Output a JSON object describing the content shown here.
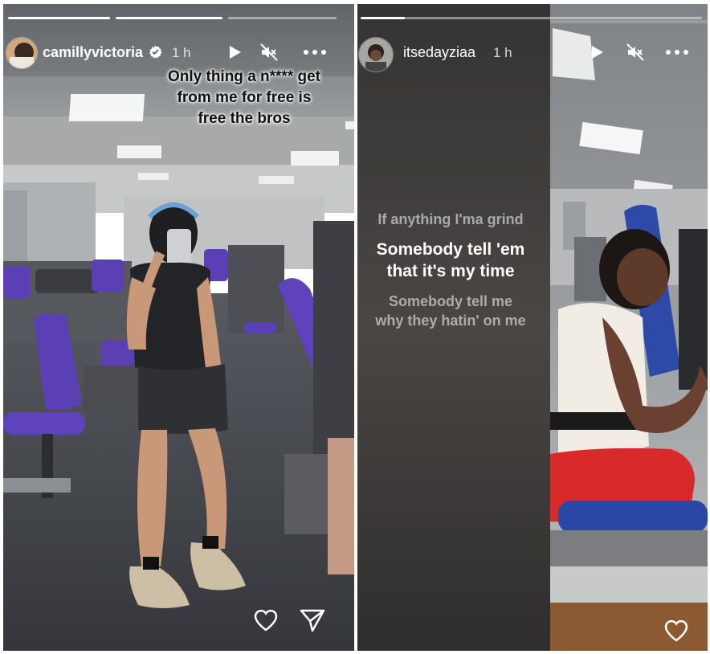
{
  "left_story": {
    "username": "camillyvictoria",
    "time": "1 h",
    "verified": true,
    "caption_lines": [
      "Only thing a n**** get",
      "from me for free is",
      "free the bros"
    ],
    "progress": [
      1,
      1,
      0
    ],
    "icons": {
      "play": "play-icon",
      "mute": "mute-icon",
      "more": "more-icon",
      "like": "heart-icon",
      "share": "send-icon"
    }
  },
  "right_story": {
    "username": "itsedayziaa",
    "time": "1 h",
    "lyrics": {
      "previous": "If anything I'ma grind",
      "current_line1": "Somebody tell 'em",
      "current_line2": "that it's my time",
      "next_line1": "Somebody tell me",
      "next_line2": "why they hatin' on me"
    },
    "progress": [
      0.18
    ],
    "icons": {
      "play": "play-icon",
      "mute": "mute-icon",
      "more": "more-icon",
      "like": "heart-icon"
    }
  },
  "colors": {
    "accent_purple": "#5b3fb5",
    "gym_floor": "#3d3f46",
    "shorts_red": "#d42a2a"
  }
}
